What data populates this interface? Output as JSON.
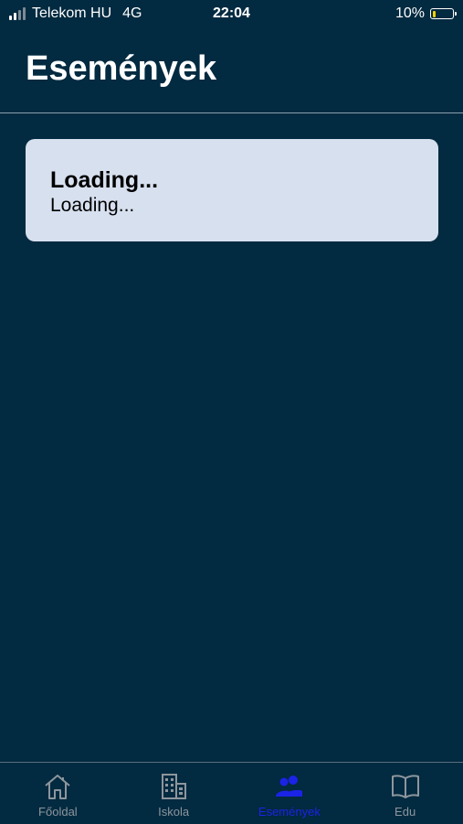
{
  "status_bar": {
    "carrier": "Telekom HU",
    "network": "4G",
    "time": "22:04",
    "battery_percent": "10%",
    "battery_level": 0.1
  },
  "header": {
    "title": "Események"
  },
  "card": {
    "title": "Loading...",
    "subtitle": "Loading..."
  },
  "tab_bar": {
    "tabs": [
      {
        "label": "Főoldal",
        "icon": "home-icon",
        "active": false
      },
      {
        "label": "Iskola",
        "icon": "building-icon",
        "active": false
      },
      {
        "label": "Események",
        "icon": "people-icon",
        "active": true
      },
      {
        "label": "Edu",
        "icon": "book-icon",
        "active": false
      }
    ]
  },
  "colors": {
    "background": "#022a40",
    "card": "#d7e0ef",
    "active_tab": "#1a23e6",
    "inactive_tab": "#8d969d"
  }
}
